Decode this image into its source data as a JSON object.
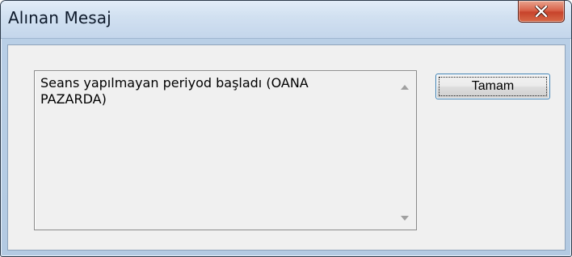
{
  "window": {
    "title": "Alınan Mesaj",
    "close_icon": "close-icon",
    "close_color": "#c7432b"
  },
  "message": {
    "text": "Seans yapılmayan periyod başladı (OANA\nPAZARDA)"
  },
  "scrollbar": {
    "up_icon": "scroll-up-arrow-icon",
    "down_icon": "scroll-down-arrow-icon"
  },
  "buttons": {
    "ok_label": "Tamam"
  }
}
